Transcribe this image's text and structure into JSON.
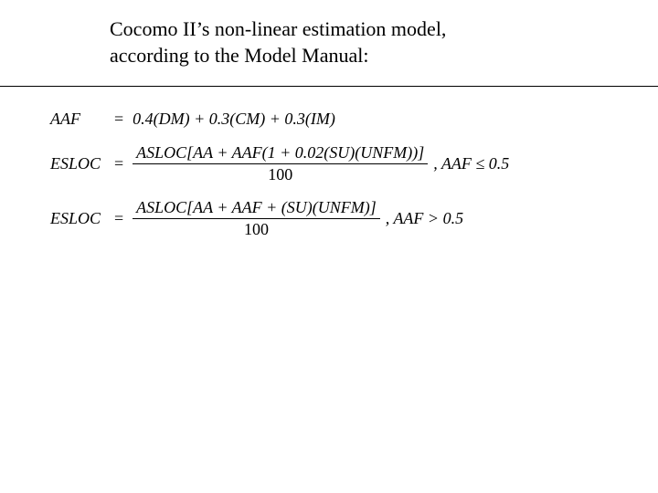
{
  "heading": {
    "line1": "Cocomo II’s non-linear estimation model,",
    "line2": "according to the Model Manual:"
  },
  "equations": {
    "aaf": {
      "lhs": "AAF",
      "rhs": "0.4(DM) + 0.3(CM) + 0.3(IM)"
    },
    "esloc_low": {
      "lhs": "ESLOC",
      "num": "ASLOC[AA + AAF(1 + 0.02(SU)(UNFM))]",
      "den": "100",
      "cond": ", AAF ≤ 0.5"
    },
    "esloc_high": {
      "lhs": "ESLOC",
      "num": "ASLOC[AA + AAF + (SU)(UNFM)]",
      "den": "100",
      "cond": ", AAF > 0.5"
    }
  }
}
